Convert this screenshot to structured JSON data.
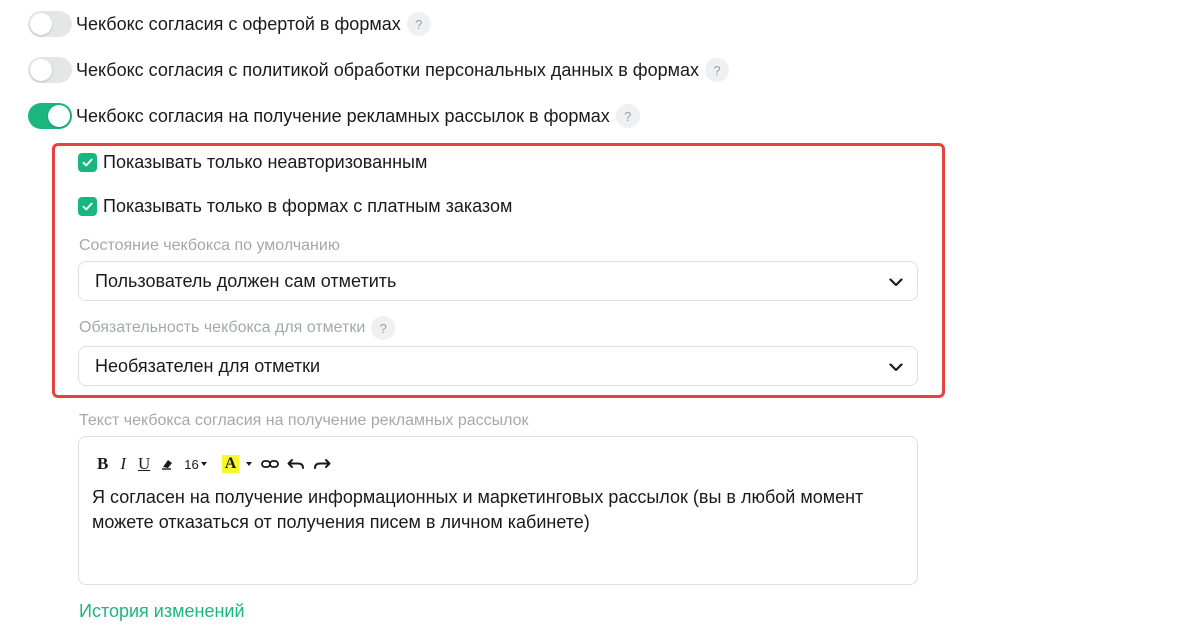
{
  "toggles": [
    {
      "label": "Чекбокс согласия с офертой в формах",
      "on": false
    },
    {
      "label": "Чекбокс согласия с политикой обработки персональных данных в формах",
      "on": false
    },
    {
      "label": "Чекбокс согласия на получение рекламных рассылок в формах",
      "on": true
    }
  ],
  "help_glyph": "?",
  "checkboxes": [
    {
      "label": "Показывать только неавторизованным",
      "checked": true
    },
    {
      "label": "Показывать только в формах с платным заказом",
      "checked": true
    }
  ],
  "default_state": {
    "label": "Состояние чекбокса по умолчанию",
    "value": "Пользователь должен сам отметить"
  },
  "required": {
    "label": "Обязательность чекбокса для отметки",
    "value": "Необязателен для отметки"
  },
  "editor": {
    "label": "Текст чекбокса согласия на получение рекламных рассылок",
    "toolbar": {
      "bold": "B",
      "italic": "I",
      "underline": "U",
      "font_size": "16",
      "highlight": "A"
    },
    "text": "Я согласен на получение информационных и маркетинговых рассылок (вы в любой момент можете отказаться от получения писем в личном кабинете)"
  },
  "history_link": "История изменений",
  "colors": {
    "accent": "#19b77f",
    "highlight_border": "#e5413f",
    "highlight_marker": "#f7f72a"
  },
  "icons": [
    "help-icon",
    "checkmark-icon",
    "chevron-down-icon",
    "eraser-icon",
    "link-icon",
    "undo-icon",
    "redo-icon"
  ]
}
